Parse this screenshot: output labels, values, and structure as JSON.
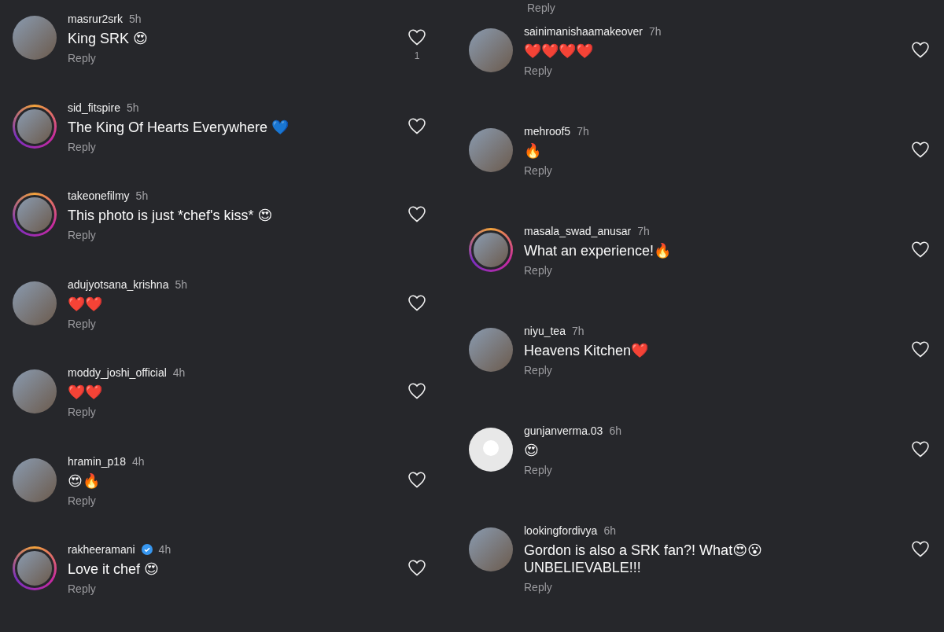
{
  "left_comments": [
    {
      "username": "masrur2srk",
      "time": "5h",
      "text": "King SRK 😍",
      "kind": "photo",
      "story": false,
      "verified": false,
      "reply": "Reply",
      "likes": "1"
    },
    {
      "username": "sid_fitspire",
      "time": "5h",
      "text": "The King Of Hearts Everywhere 💙",
      "kind": "photo",
      "story": true,
      "verified": false,
      "reply": "Reply"
    },
    {
      "username": "takeonefilmy",
      "time": "5h",
      "text": "This photo is just *chef's kiss* 😍",
      "kind": "photo",
      "story": true,
      "verified": false,
      "reply": "Reply"
    },
    {
      "username": "adujyotsana_krishna",
      "time": "5h",
      "text": "❤️❤️",
      "kind": "photo",
      "story": false,
      "verified": false,
      "reply": "Reply"
    },
    {
      "username": "moddy_joshi_official",
      "time": "4h",
      "text": "❤️❤️",
      "kind": "photo",
      "story": false,
      "verified": false,
      "reply": "Reply"
    },
    {
      "username": "hramin_p18",
      "time": "4h",
      "text": "😍🔥",
      "kind": "photo",
      "story": false,
      "verified": false,
      "reply": "Reply"
    },
    {
      "username": "rakheeramani",
      "time": "4h",
      "text": "Love it chef 😍",
      "kind": "photo",
      "story": true,
      "verified": true,
      "reply": "Reply"
    }
  ],
  "right_top_reply": "Reply",
  "right_comments": [
    {
      "username": "sainimanishaamakeover",
      "time": "7h",
      "text": "❤️❤️❤️❤️",
      "kind": "photo",
      "story": false,
      "verified": false,
      "reply": "Reply"
    },
    {
      "username": "mehroof5",
      "time": "7h",
      "text": "🔥",
      "kind": "photo",
      "story": false,
      "verified": false,
      "reply": "Reply"
    },
    {
      "username": "masala_swad_anusar",
      "time": "7h",
      "text": "What an experience!🔥",
      "kind": "photo",
      "story": true,
      "verified": false,
      "reply": "Reply"
    },
    {
      "username": "niyu_tea",
      "time": "7h",
      "text": "Heavens Kitchen❤️",
      "kind": "photo",
      "story": false,
      "verified": false,
      "reply": "Reply"
    },
    {
      "username": "gunjanverma.03",
      "time": "6h",
      "text": "😍",
      "kind": "default",
      "story": false,
      "verified": false,
      "reply": "Reply"
    },
    {
      "username": "lookingfordivya",
      "time": "6h",
      "text": "Gordon is also a SRK fan?! What😍😮 UNBELIEVABLE!!!",
      "kind": "photo",
      "story": false,
      "verified": false,
      "reply": "Reply"
    }
  ]
}
